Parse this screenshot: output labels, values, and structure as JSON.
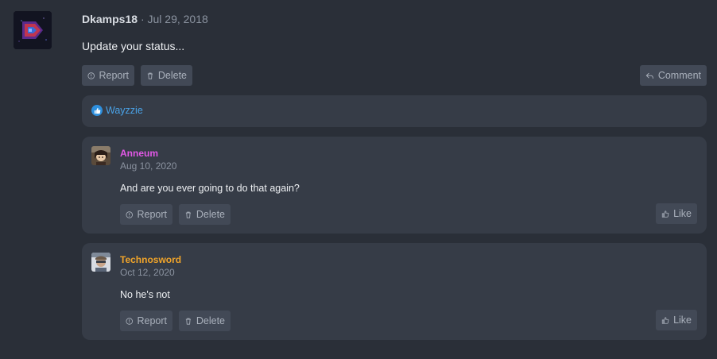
{
  "post": {
    "author": "Dkamps18",
    "separator": "·",
    "date": "Jul 29, 2018",
    "text": "Update your status...",
    "report_label": "Report",
    "delete_label": "Delete",
    "comment_label": "Comment"
  },
  "likes": {
    "users": "Wayzzie"
  },
  "comments": [
    {
      "author": "Anneum",
      "author_color": "#e158e6",
      "date": "Aug 10, 2020",
      "text": "And are you ever going to do that again?",
      "report_label": "Report",
      "delete_label": "Delete",
      "like_label": "Like"
    },
    {
      "author": "Technosword",
      "author_color": "#f0a42a",
      "date": "Oct 12, 2020",
      "text": "No he's not",
      "report_label": "Report",
      "delete_label": "Delete",
      "like_label": "Like"
    }
  ],
  "colors": {
    "background": "#2a2f38",
    "panel": "#363c47",
    "button": "#424956",
    "link_blue": "#4aa3e8"
  }
}
